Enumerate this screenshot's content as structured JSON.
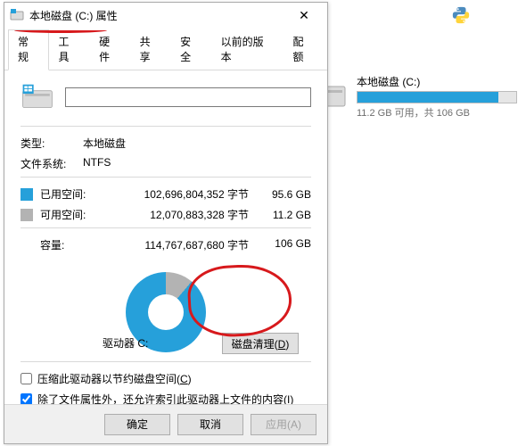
{
  "chart_data": {
    "type": "pie",
    "title": "驱动器 C:",
    "slices": [
      {
        "name": "已用空间",
        "value": 95.6,
        "color": "#26a0da"
      },
      {
        "name": "可用空间",
        "value": 11.2,
        "color": "#b3b3b3"
      }
    ],
    "unit": "GB",
    "total": 106
  },
  "bg_disk": {
    "name": "本地磁盘 (C:)",
    "subtext": "11.2 GB 可用，共 106 GB",
    "fill_pct": 89
  },
  "dialog": {
    "title": "本地磁盘 (C:) 属性",
    "close": "✕",
    "tabs": [
      "常规",
      "工具",
      "硬件",
      "共享",
      "安全",
      "以前的版本",
      "配额"
    ],
    "active_tab": 0,
    "general": {
      "type_label": "类型:",
      "type_value": "本地磁盘",
      "fs_label": "文件系统:",
      "fs_value": "NTFS",
      "used_label": "已用空间:",
      "used_bytes": "102,696,804,352 字节",
      "used_size": "95.6 GB",
      "free_label": "可用空间:",
      "free_bytes": "12,070,883,328 字节",
      "free_size": "11.2 GB",
      "cap_label": "容量:",
      "cap_bytes": "114,767,687,680 字节",
      "cap_size": "106 GB",
      "drive_label": "驱动器 C:",
      "cleanup_btn_pre": "磁盘清理(",
      "cleanup_btn_u": "D",
      "cleanup_btn_post": ")",
      "compress_pre": "压缩此驱动器以节约磁盘空间(",
      "compress_u": "C",
      "compress_post": ")",
      "index_pre": "除了文件属性外，还允许索引此驱动器上文件的内容(",
      "index_u": "I",
      "index_post": ")",
      "compress_checked": false,
      "index_checked": true
    },
    "footer": {
      "ok": "确定",
      "cancel": "取消",
      "apply": "应用(A)"
    }
  }
}
